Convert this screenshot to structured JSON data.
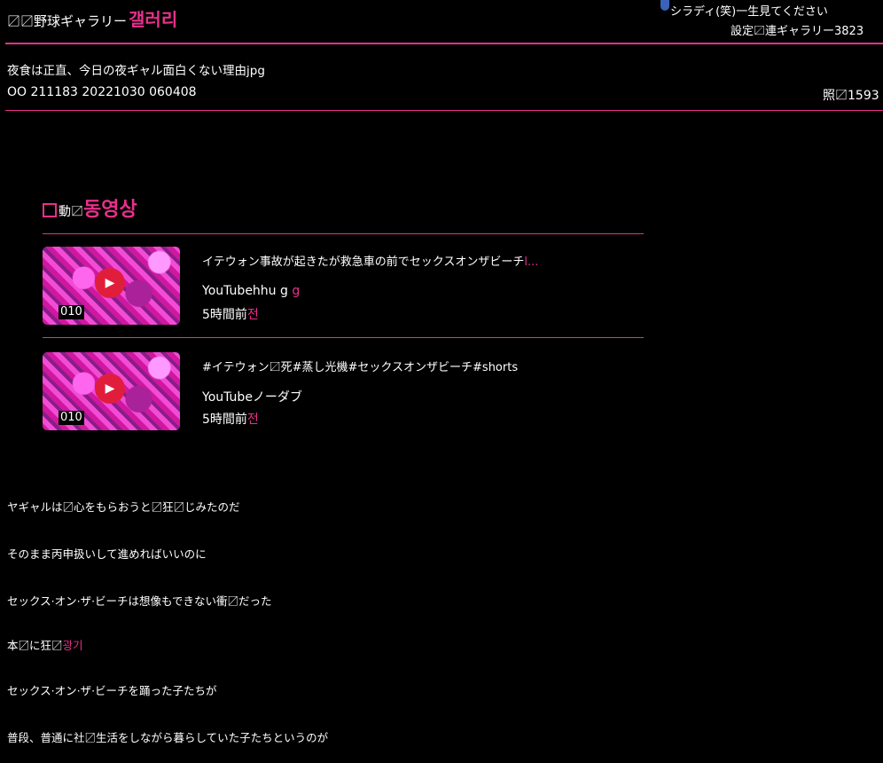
{
  "header": {
    "title": "〼〼野球ギャラリー",
    "title_ko": "갤러리",
    "notice": "シラディ(笑)一生見てください",
    "settings": "設定〼連ギャラリー3823"
  },
  "post": {
    "title": "夜食は正直、今日の夜ギャル面白くない理由jpg",
    "meta": "OO 211183 20221030 060408",
    "views": "照〼1593"
  },
  "videos_section": {
    "heading_prefix": "動〼",
    "heading_ko": "동영상",
    "items": [
      {
        "title": "イテウォン事故が起きたが救急車の前でセックスオンザビーチ",
        "title_suffix": "l...",
        "channel": "YouTubehhu g",
        "channel_suffix": "g",
        "time": "5時間前",
        "time_suffix": "전",
        "duration": "010"
      },
      {
        "title": "#イテウォン〼死#蒸し光機#セックスオンザビーチ#shorts",
        "title_suffix": "",
        "channel": "YouTubeノーダブ",
        "channel_suffix": "",
        "time": "5時間前",
        "time_suffix": "전",
        "duration": "010"
      }
    ]
  },
  "body": {
    "lines": [
      "ヤギャルは〼心をもらおうと〼狂〼じみたのだ",
      "そのまま丙申扱いして進めればいいのに",
      "セックス·オン·ザ·ビーチは想像もできない衝〼だった",
      "本〼に狂〼",
      "セックス·オン·ザ·ビーチを踊った子たちが",
      "普段、普通に社〼生活をしながら暮らしていた子たちというのが"
    ],
    "line4_suffix": "광기"
  },
  "colors": {
    "accent": "#e8308a",
    "background": "#000000",
    "text": "#ffffff"
  }
}
